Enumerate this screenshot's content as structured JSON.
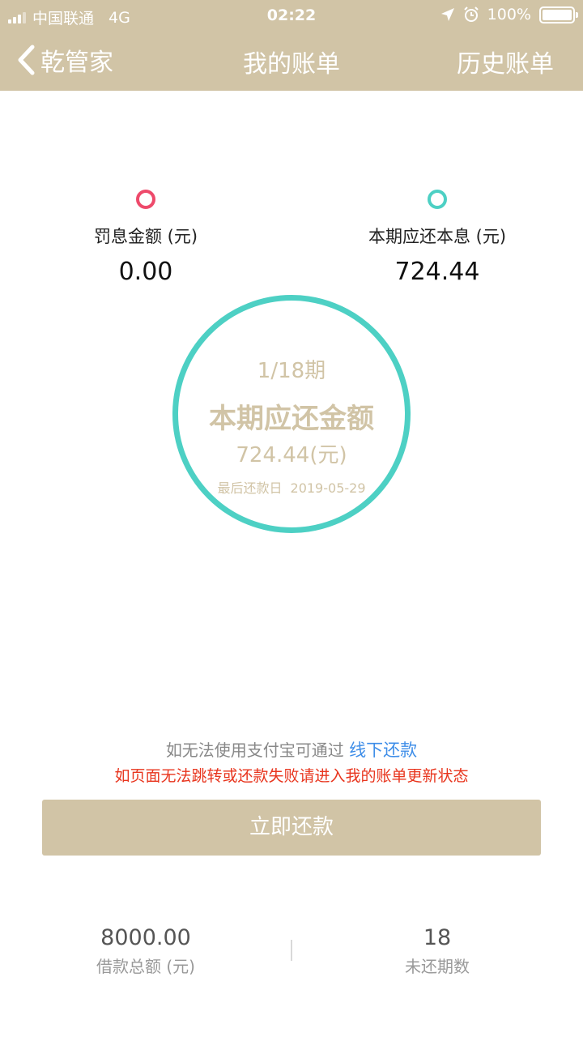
{
  "status_bar": {
    "carrier": "中国联通",
    "network": "4G",
    "time": "02:22",
    "battery": "100%"
  },
  "nav": {
    "back_label": "乾管家",
    "title": "我的账单",
    "history_label": "历史账单"
  },
  "stats": {
    "penalty": {
      "label": "罚息金额 (元)",
      "value": "0.00",
      "color": "#ee4a6b"
    },
    "principal_interest": {
      "label": "本期应还本息 (元)",
      "value": "724.44",
      "color": "#4dd0c4"
    }
  },
  "ring": {
    "period": "1/18期",
    "title": "本期应还金额",
    "amount": "724.44(元)",
    "due_label": "最后还款日",
    "due_date": "2019-05-29",
    "color": "#4dd0c4"
  },
  "notes": {
    "alipay_text": "如无法使用支付宝可通过",
    "offline_link": "线下还款",
    "warning": "如页面无法跳转或还款失败请进入我的账单更新状态"
  },
  "pay_button": {
    "label": "立即还款"
  },
  "summary": {
    "total": {
      "value": "8000.00",
      "label": "借款总额 (元)"
    },
    "remaining": {
      "value": "18",
      "label": "未还期数"
    }
  },
  "colors": {
    "brand": "#d1c4a6",
    "accent_teal": "#4dd0c4",
    "accent_pink": "#ee4a6b",
    "link_blue": "#3f8ee8",
    "warning_red": "#e8351e"
  }
}
